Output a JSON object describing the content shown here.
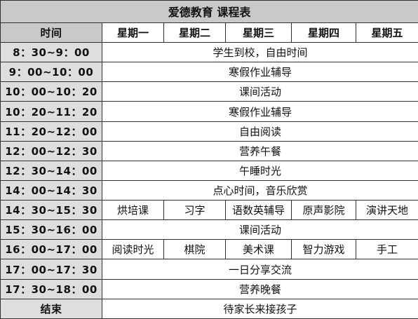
{
  "title": "爱德教育 课程表",
  "time_header": "时间",
  "days": [
    "星期一",
    "星期二",
    "星期三",
    "星期四",
    "星期五"
  ],
  "rows": [
    {
      "time": "8：30~9：00",
      "activity": "学生到校，自由时间"
    },
    {
      "time": "9：00~10：00",
      "activity": "寒假作业辅导"
    },
    {
      "time": "10：00~10：20",
      "activity": "课间活动"
    },
    {
      "time": "10：20~11：20",
      "activity": "寒假作业辅导"
    },
    {
      "time": "11：20~12：00",
      "activity": "自由阅读"
    },
    {
      "time": "12：00~12：30",
      "activity": "营养午餐"
    },
    {
      "time": "12：30~14：00",
      "activity": "午睡时光"
    },
    {
      "time": "14：00~14：30",
      "activity": "点心时间，音乐欣赏"
    },
    {
      "time": "14：30~15：30",
      "per_day": [
        "烘培课",
        "习字",
        "语数英辅导",
        "原声影院",
        "演讲天地"
      ]
    },
    {
      "time": "15：30~16：00",
      "activity": "课间活动"
    },
    {
      "time": "16：00~17：00",
      "per_day": [
        "阅读时光",
        "棋院",
        "美术课",
        "智力游戏",
        "手工"
      ]
    },
    {
      "time": "17：00~17：30",
      "activity": "一日分享交流"
    },
    {
      "time": "17：30~18：00",
      "activity": "营养晚餐"
    },
    {
      "time": "结束",
      "activity": "待家长来接孩子"
    }
  ]
}
